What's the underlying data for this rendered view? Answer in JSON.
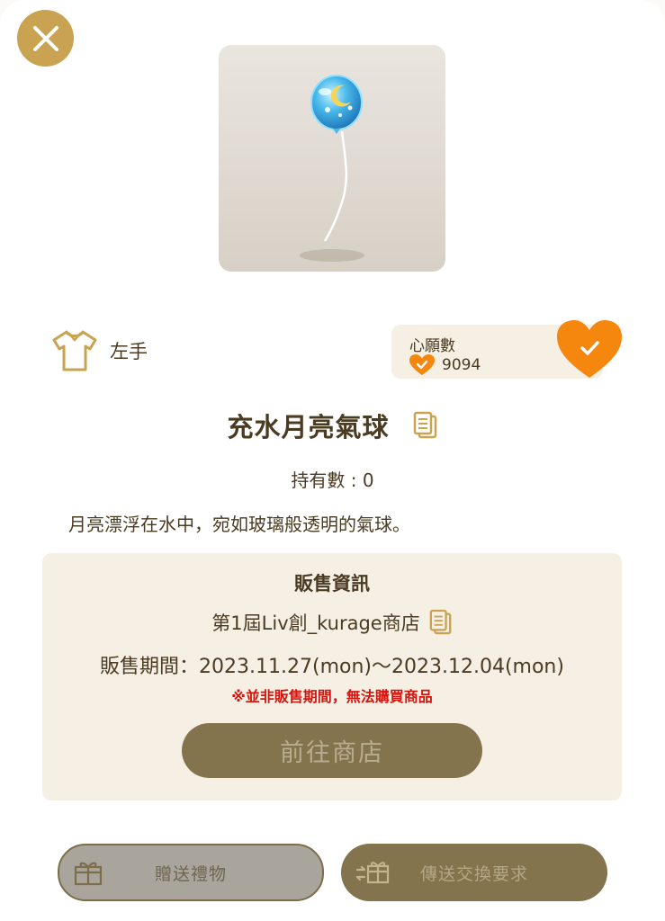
{
  "item": {
    "slot_label": "左手",
    "name": "充水月亮氣球",
    "owned_text": "持有數 : 0",
    "description": "月亮漂浮在水中，宛如玻璃般透明的氣球。"
  },
  "wishlist": {
    "title": "心願數",
    "count": "9094"
  },
  "sale_info": {
    "title": "販售資訊",
    "shop_name": "第1屆Liv創_kurage商店",
    "period": "販售期間：2023.11.27(mon)～2023.12.04(mon)",
    "warning": "※並非販售期間，無法購買商品",
    "goto_shop_label": "前往商店"
  },
  "actions": {
    "gift_label": "贈送禮物",
    "trade_label": "傳送交換要求"
  },
  "colors": {
    "accent_gold": "#c9a352",
    "heart_orange": "#f5870f",
    "button_brown": "#84744d",
    "panel_beige": "#f5efe4",
    "warning_red": "#d4160f"
  },
  "icons": [
    "close-icon",
    "shirt-icon",
    "heart-icon",
    "heart-check-icon",
    "copy-icon",
    "gift-icon",
    "trade-icon"
  ]
}
